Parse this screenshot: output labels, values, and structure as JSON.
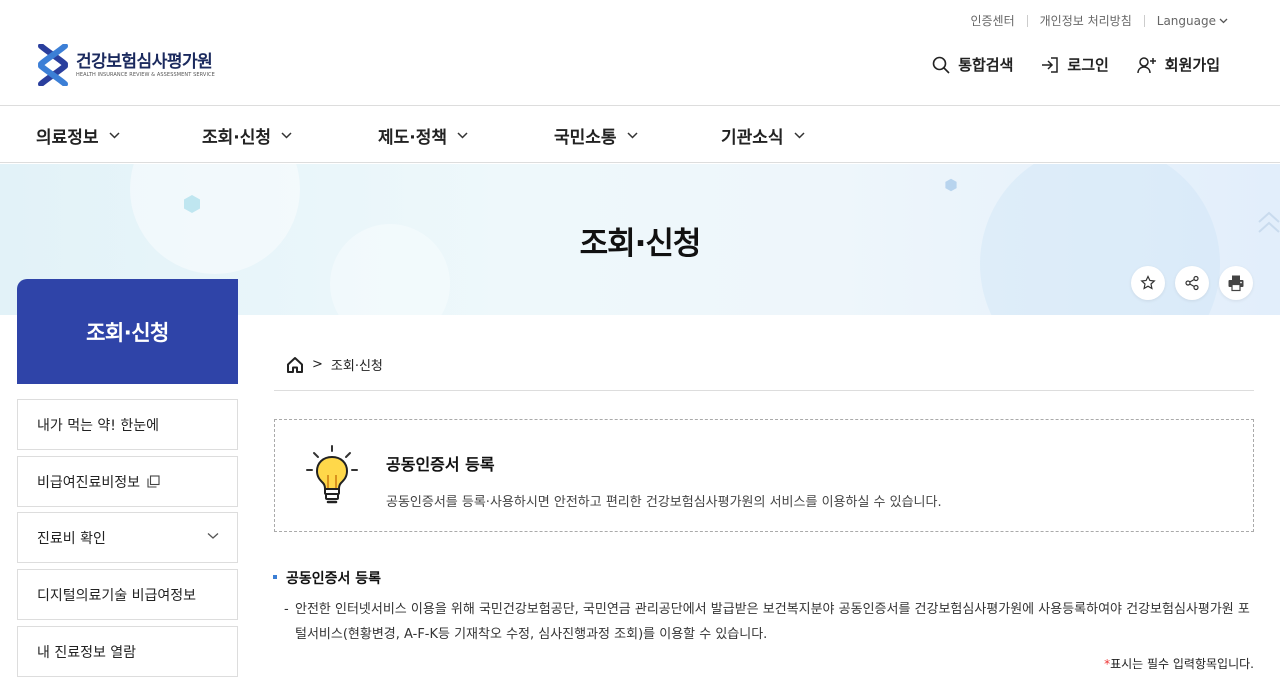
{
  "utility": {
    "cert_center": "인증센터",
    "privacy": "개인정보 처리방침",
    "language": "Language"
  },
  "logo": {
    "name": "건강보험심사평가원",
    "sub": "HEALTH INSURANCE REVIEW & ASSESSMENT SERVICE"
  },
  "actions": {
    "search": "통합검색",
    "login": "로그인",
    "signup": "회원가입"
  },
  "gnb": [
    "의료정보",
    "조회·신청",
    "제도·정책",
    "국민소통",
    "기관소식"
  ],
  "hero": {
    "title": "조회·신청"
  },
  "side": {
    "title": "조회·신청",
    "items": [
      "내가 먹는 약! 한눈에",
      "비급여진료비정보",
      "진료비 확인",
      "디지털의료기술 비급여정보",
      "내 진료정보 열람"
    ]
  },
  "breadcrumb": {
    "current": "조회·신청"
  },
  "notice": {
    "title": "공동인증서 등록",
    "desc": "공동인증서를 등록·사용하시면 안전하고 편리한 건강보험심사평가원의 서비스를 이용하실 수 있습니다."
  },
  "section": {
    "title": "공동인증서 등록",
    "dash": "-",
    "body": "안전한 인터넷서비스 이용을 위해 국민건강보험공단, 국민연금 관리공단에서 발급받은 보건복지분야 공동인증서를 건강보험심사평가원에 사용등록하여야 건강보험심사평가원 포털서비스(현황변경, A-F-K등 기재착오 수정, 심사진행과정 조회)를 이용할 수 있습니다."
  },
  "required": {
    "star": "*",
    "text": "표시는 필수 입력항목입니다."
  },
  "colors": {
    "primary": "#2f44a8",
    "accent": "#3b7ed4",
    "required": "#e33333"
  }
}
